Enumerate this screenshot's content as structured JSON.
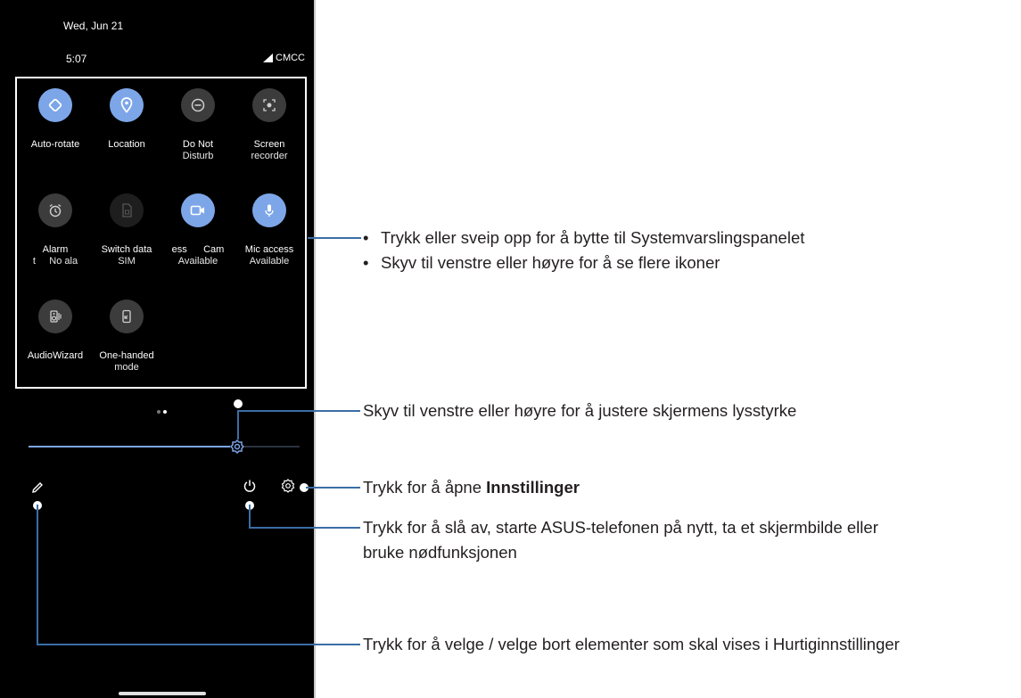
{
  "status_bar": {
    "date": "Wed, Jun 21",
    "time": "5:07",
    "carrier": "CMCC"
  },
  "tiles": [
    {
      "label": "Auto-rotate",
      "sub": "",
      "state": "on",
      "icon": "auto-rotate-icon"
    },
    {
      "label": "Location",
      "sub": "",
      "state": "on",
      "icon": "location-pin-icon"
    },
    {
      "label": "Do Not",
      "sub": "Disturb",
      "state": "off",
      "icon": "do-not-disturb-icon"
    },
    {
      "label": "Screen",
      "sub": "recorder",
      "state": "off",
      "icon": "screen-recorder-icon"
    },
    {
      "label": "Alarm",
      "sub": "t     No ala",
      "state": "off",
      "icon": "alarm-clock-icon"
    },
    {
      "label": "Switch data",
      "sub": "SIM",
      "state": "dim",
      "icon": "sim-card-icon"
    },
    {
      "label": "ess      Cam",
      "sub": "Available",
      "state": "on",
      "icon": "camera-access-icon"
    },
    {
      "label": "Mic access",
      "sub": "Available",
      "state": "on",
      "icon": "microphone-icon"
    },
    {
      "label": "AudioWizard",
      "sub": "",
      "state": "off",
      "icon": "audiowizard-icon"
    },
    {
      "label": "One-handed",
      "sub": "mode",
      "state": "off",
      "icon": "one-handed-mode-icon"
    }
  ],
  "brightness": {
    "level": 0.78
  },
  "annotations": {
    "swipe_up": "Trykk eller sveip opp for å bytte til Systemvarslingspanelet",
    "slide_icons": "Skyv til venstre eller høyre for å se flere ikoner",
    "brightness": "Skyv til venstre eller høyre for å justere skjermens lysstyrke",
    "settings_prefix": "Trykk for å åpne ",
    "settings_bold": "Innstillinger",
    "power_line1": "Trykk for å slå av, starte ASUS-telefonen på nytt, ta et skjermbilde eller",
    "power_line2": "bruke nødfunksjonen",
    "edit": "Trykk for å velge / velge bort elementer som skal vises i Hurtiginnstillinger"
  },
  "colors": {
    "accent": "#7da6e8",
    "tile_off": "#3c3c3c",
    "callout_line": "#3a6ea5"
  }
}
